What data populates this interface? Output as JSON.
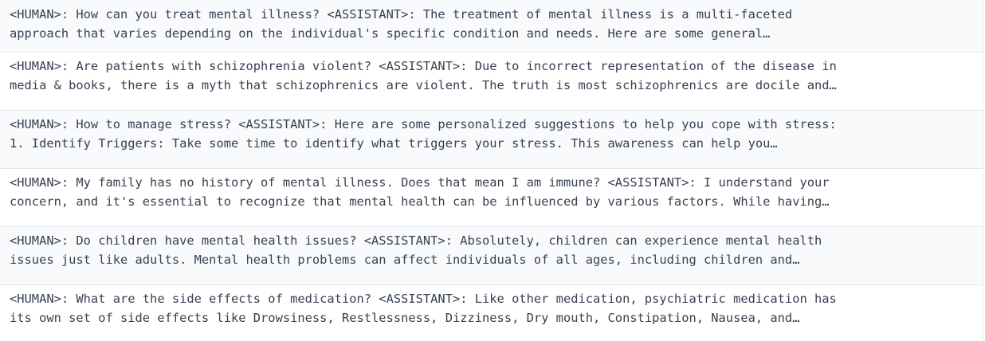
{
  "rows": [
    {
      "line1": "<HUMAN>: How can you treat mental illness? <ASSISTANT>: The treatment of mental illness is a multi-faceted",
      "line2": "approach that varies depending on the individual's specific condition and needs. Here are some general…"
    },
    {
      "line1": "<HUMAN>: Are patients with schizophrenia violent? <ASSISTANT>: Due to incorrect representation of the disease in",
      "line2": "media & books, there is a myth that schizophrenics are violent. The truth is most schizophrenics are docile and…"
    },
    {
      "line1": "<HUMAN>: How to manage stress? <ASSISTANT>: Here are some personalized suggestions to help you cope with stress:",
      "line2": "1. Identify Triggers: Take some time to identify what triggers your stress. This awareness can help you…"
    },
    {
      "line1": "<HUMAN>: My family has no history of mental illness. Does that mean I am immune? <ASSISTANT>: I understand your",
      "line2": "concern, and it's essential to recognize that mental health can be influenced by various factors. While having…"
    },
    {
      "line1": "<HUMAN>: Do children have mental health issues? <ASSISTANT>: Absolutely, children can experience mental health",
      "line2": "issues just like adults. Mental health problems can affect individuals of all ages, including children and…"
    },
    {
      "line1": "<HUMAN>: What are the side effects of medication? <ASSISTANT>: Like other medication, psychiatric medication has",
      "line2": "its own set of side effects like Drowsiness, Restlessness, Dizziness, Dry mouth, Constipation, Nausea, and…"
    }
  ]
}
